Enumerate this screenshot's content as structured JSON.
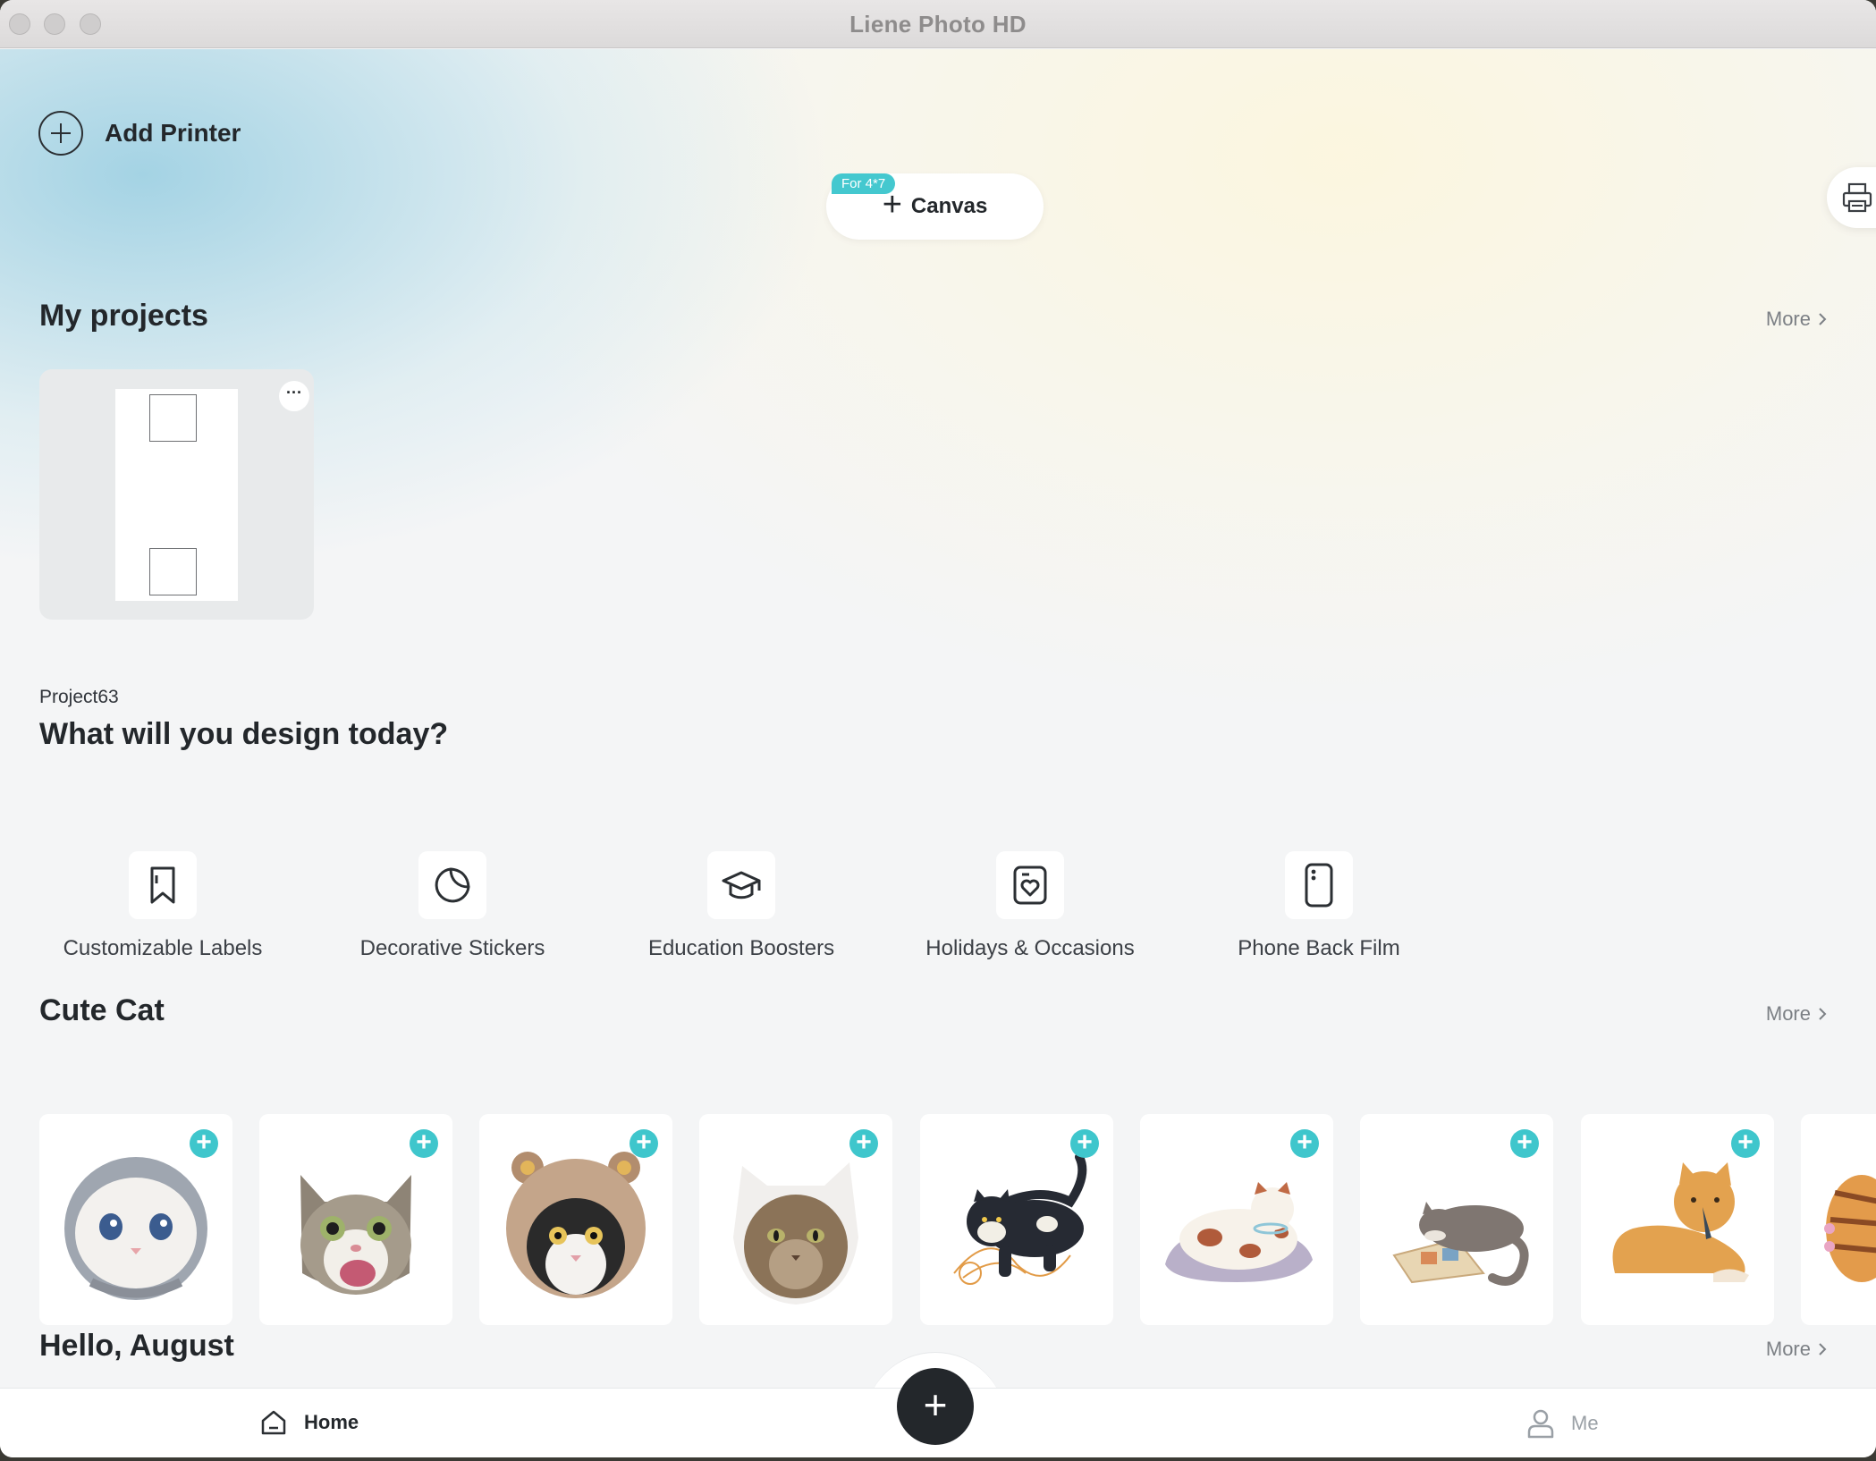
{
  "window": {
    "title": "Liene Photo HD"
  },
  "header": {
    "add_printer_label": "Add Printer",
    "canvas_badge": "For 4*7",
    "canvas_label": "Canvas"
  },
  "projects": {
    "title": "My projects",
    "more_label": "More",
    "items": [
      {
        "name": "Project63"
      }
    ]
  },
  "design": {
    "title": "What will you design today?",
    "categories": [
      {
        "label": "Customizable Labels",
        "icon": "bookmark-icon"
      },
      {
        "label": "Decorative Stickers",
        "icon": "sticker-icon"
      },
      {
        "label": "Education Boosters",
        "icon": "graduation-cap-icon"
      },
      {
        "label": "Holidays & Occasions",
        "icon": "heart-card-icon"
      },
      {
        "label": "Phone Back Film",
        "icon": "phone-back-icon"
      }
    ]
  },
  "cute_cat": {
    "title": "Cute Cat",
    "more_label": "More",
    "stickers": [
      {
        "name": "white-kitten-photo"
      },
      {
        "name": "surprised-tabby-photo"
      },
      {
        "name": "bear-hat-cat-photo"
      },
      {
        "name": "white-hood-cat-photo"
      },
      {
        "name": "cat-with-yarn-illustration"
      },
      {
        "name": "spotted-cat-cushion-illustration"
      },
      {
        "name": "gray-cat-reading-illustration"
      },
      {
        "name": "orange-cat-lying-illustration"
      },
      {
        "name": "tiger-cat-partial-illustration"
      }
    ]
  },
  "hello_august": {
    "title": "Hello, August",
    "more_label": "More"
  },
  "bottom_nav": {
    "home_label": "Home",
    "me_label": "Me",
    "fab_symbol": "+"
  },
  "colors": {
    "accent": "#3fc6cc",
    "dark": "#23272b",
    "muted": "#7c8085"
  }
}
